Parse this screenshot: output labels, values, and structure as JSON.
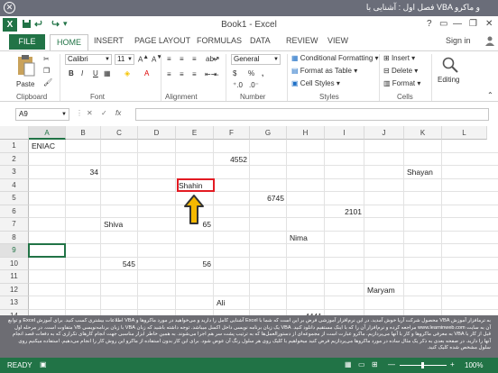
{
  "top_bar": {
    "title": "فصل اول : آشنایی با VBA و ماکرو"
  },
  "window": {
    "title": "Book1 - Excel",
    "logo": "X",
    "help": "?",
    "minimize": "—",
    "restore": "❐",
    "close": "✕"
  },
  "tabs": [
    {
      "label": "FILE"
    },
    {
      "label": "HOME"
    },
    {
      "label": "INSERT"
    },
    {
      "label": "PAGE LAYOUT"
    },
    {
      "label": "FORMULAS"
    },
    {
      "label": "DATA"
    },
    {
      "label": "REVIEW"
    },
    {
      "label": "VIEW"
    }
  ],
  "sign_in": "Sign in",
  "ribbon": {
    "paste_label": "Paste",
    "clipboard": "Clipboard",
    "font_name": "Calibri",
    "font_size": "11",
    "font_group": "Font",
    "bold": "B",
    "italic": "I",
    "underline": "U",
    "alignment": "Alignment",
    "number_format": "General",
    "number": "Number",
    "conditional_formatting": "Conditional Formatting",
    "format_as_table": "Format as Table",
    "cell_styles": "Cell Styles",
    "styles": "Styles",
    "insert": "Insert",
    "delete": "Delete",
    "format": "Format",
    "cells": "Cells",
    "editing": "Editing",
    "currency_symbol": "$",
    "percent_symbol": "%",
    "comma_symbol": ","
  },
  "formula_bar": {
    "name_box": "A9",
    "fx": "fx",
    "cancel": "✕",
    "enter": "✓"
  },
  "columns": [
    "A",
    "B",
    "C",
    "D",
    "E",
    "F",
    "G",
    "H",
    "I",
    "J",
    "K",
    "L"
  ],
  "rows": [
    "1",
    "2",
    "3",
    "4",
    "5",
    "6",
    "7",
    "8",
    "9",
    "10",
    "11",
    "12",
    "13",
    "14"
  ],
  "cells": {
    "A1": "ENIAC",
    "F2": "4552",
    "B3": "34",
    "K3": "Shayan",
    "E4": "Shahin",
    "G5": "6745",
    "I6": "2101",
    "C7": "Shiva",
    "E7": "65",
    "H8": "Nima",
    "C10": "545",
    "E10": "56",
    "J12": "Maryam",
    "F13": "Ali",
    "H14": "4441"
  },
  "selected_cell": "A9",
  "highlighted_cell": "E4",
  "annotation_arrow_color": "#f5b800",
  "highlight_color": "#e31b23",
  "caption": "به ترمافزار آموزش VBA محصول شرکت آریا خوش آمدید. در این نرم‌افزار آموزشی فرض بر این است که شما با Excel آشنایی کامل را دارید و می‌خواهید در مورد ماکروها و VBA اطلاعات بیشتری کسب کنید. برای آموزش Excel و توابع آن به سایت www.learninweb.com مراجعه کرده و نرم‌افزار آن را که با اینک مستقیم دانلود کنید. VBA یک زبان برنامه نویسی داخل اکسل میباشد. توجه داشته باشید که زبان VBA با زبان برنامه‌نویسی VB متفاوت است. در مرحله اول قبل از کار با VBA به معرفی ماکروها و کار با آنها می‌پردازیم. ماکرو عبارت است از مجموعه‌ای از دستورالعمل‌ها که به ترتیب پشت سر هم اجرا می‌شوند. به همین خاطر ابزار مناسبی جهت انجام کارهای تکراری که به دفعات قصد انجام آنها را دارید. در صفحه بعدی به ذکر یک مثال ساده در مورد ماکروها می‌پردازیم فرض کنید میخواهیم با کلیک روی هر سلول رنگ آن عوض شود. برای این کار بدون استفاده از ماکرو این روش کار را انجام می‌دهیم. استفاده میکنیم روی سلول مشخص شده کلیک کنید.",
  "status": {
    "ready": "READY",
    "zoom": "100%",
    "zoom_minus": "—",
    "zoom_plus": "+"
  }
}
